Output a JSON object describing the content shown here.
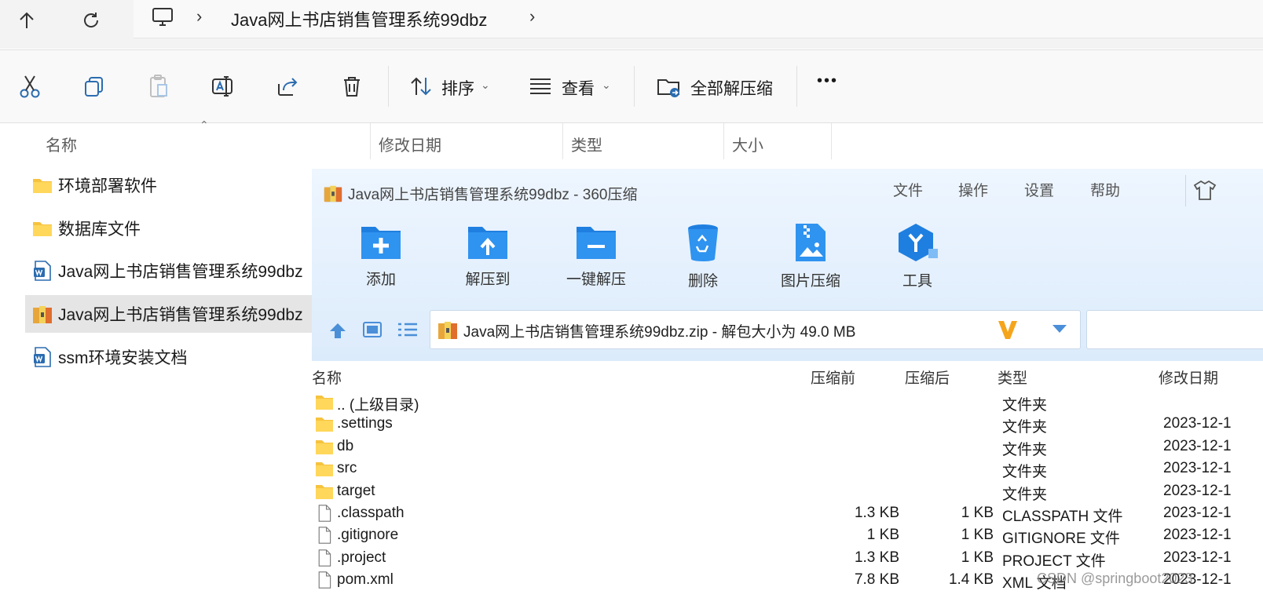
{
  "address_bar": {
    "crumb": "Java网上书店销售管理系统99dbz"
  },
  "command_bar": {
    "sort_label": "排序",
    "view_label": "查看",
    "extract_all_label": "全部解压缩",
    "more_label": "•••"
  },
  "columns": {
    "name": "名称",
    "modified": "修改日期",
    "type": "类型",
    "size": "大小"
  },
  "files": [
    {
      "name": "环境部署软件",
      "icon": "folder-icon"
    },
    {
      "name": "数据库文件",
      "icon": "folder-icon"
    },
    {
      "name": "Java网上书店销售管理系统99dbz",
      "icon": "word-doc-icon"
    },
    {
      "name": "Java网上书店销售管理系统99dbz",
      "icon": "archive-icon",
      "selected": true
    },
    {
      "name": "ssm环境安装文档",
      "icon": "word-doc-icon"
    }
  ],
  "zip_window": {
    "title": "Java网上书店销售管理系统99dbz - 360压缩",
    "menu": [
      "文件",
      "操作",
      "设置",
      "帮助"
    ],
    "tools": [
      "添加",
      "解压到",
      "一键解压",
      "删除",
      "图片压缩",
      "工具"
    ],
    "path": "Java网上书店销售管理系统99dbz.zip - 解包大小为 49.0 MB",
    "columns": {
      "name": "名称",
      "before": "压缩前",
      "after": "压缩后",
      "type": "类型",
      "modified": "修改日期"
    },
    "rows": [
      {
        "name": ".. (上级目录)",
        "before": "",
        "after": "",
        "type": "文件夹",
        "modified": "",
        "icon": "folder-icon"
      },
      {
        "name": ".settings",
        "before": "",
        "after": "",
        "type": "文件夹",
        "modified": "2023-12-1",
        "icon": "folder-icon"
      },
      {
        "name": "db",
        "before": "",
        "after": "",
        "type": "文件夹",
        "modified": "2023-12-1",
        "icon": "folder-icon"
      },
      {
        "name": "src",
        "before": "",
        "after": "",
        "type": "文件夹",
        "modified": "2023-12-1",
        "icon": "folder-icon"
      },
      {
        "name": "target",
        "before": "",
        "after": "",
        "type": "文件夹",
        "modified": "2023-12-1",
        "icon": "folder-icon"
      },
      {
        "name": ".classpath",
        "before": "1.3 KB",
        "after": "1 KB",
        "type": "CLASSPATH 文件",
        "modified": "2023-12-1",
        "icon": "file-icon"
      },
      {
        "name": ".gitignore",
        "before": "1 KB",
        "after": "1 KB",
        "type": "GITIGNORE 文件",
        "modified": "2023-12-1",
        "icon": "file-icon"
      },
      {
        "name": ".project",
        "before": "1.3 KB",
        "after": "1 KB",
        "type": "PROJECT 文件",
        "modified": "2023-12-1",
        "icon": "file-icon"
      },
      {
        "name": "pom.xml",
        "before": "7.8 KB",
        "after": "1.4 KB",
        "type": "XML 文档",
        "modified": "2023-12-1",
        "icon": "file-icon"
      }
    ]
  },
  "watermark": "CSDN @springboot2023"
}
